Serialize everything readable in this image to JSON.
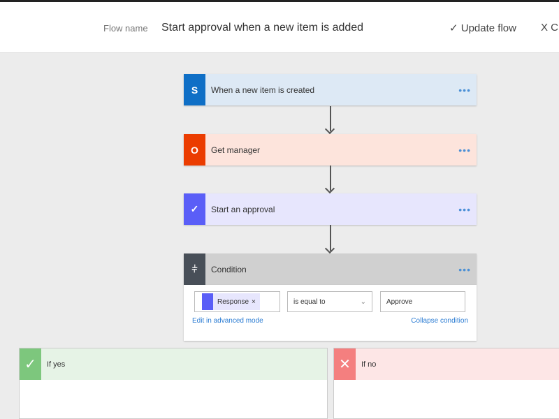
{
  "header": {
    "flow_name_label": "Flow name",
    "flow_name": "Start approval when a new item is added",
    "update_label": "✓ Update flow",
    "close_label": "X C"
  },
  "steps": [
    {
      "title": "When a new item is created",
      "icon": "sharepoint-icon",
      "color": "#0f6fc6",
      "bg": "#dde9f5"
    },
    {
      "title": "Get manager",
      "icon": "office-icon",
      "color": "#eb3c00",
      "bg": "#fde4dc"
    },
    {
      "title": "Start an approval",
      "icon": "approval-icon",
      "color": "#5a5ef7",
      "bg": "#e7e6fd"
    }
  ],
  "more": "•••",
  "condition": {
    "title": "Condition",
    "icon": "condition-icon",
    "token": "Response",
    "token_remove": "×",
    "operator": "is equal to",
    "value": "Approve",
    "advanced_link": "Edit in advanced mode",
    "collapse_link": "Collapse condition"
  },
  "branches": {
    "yes": "If yes",
    "no": "If no"
  }
}
